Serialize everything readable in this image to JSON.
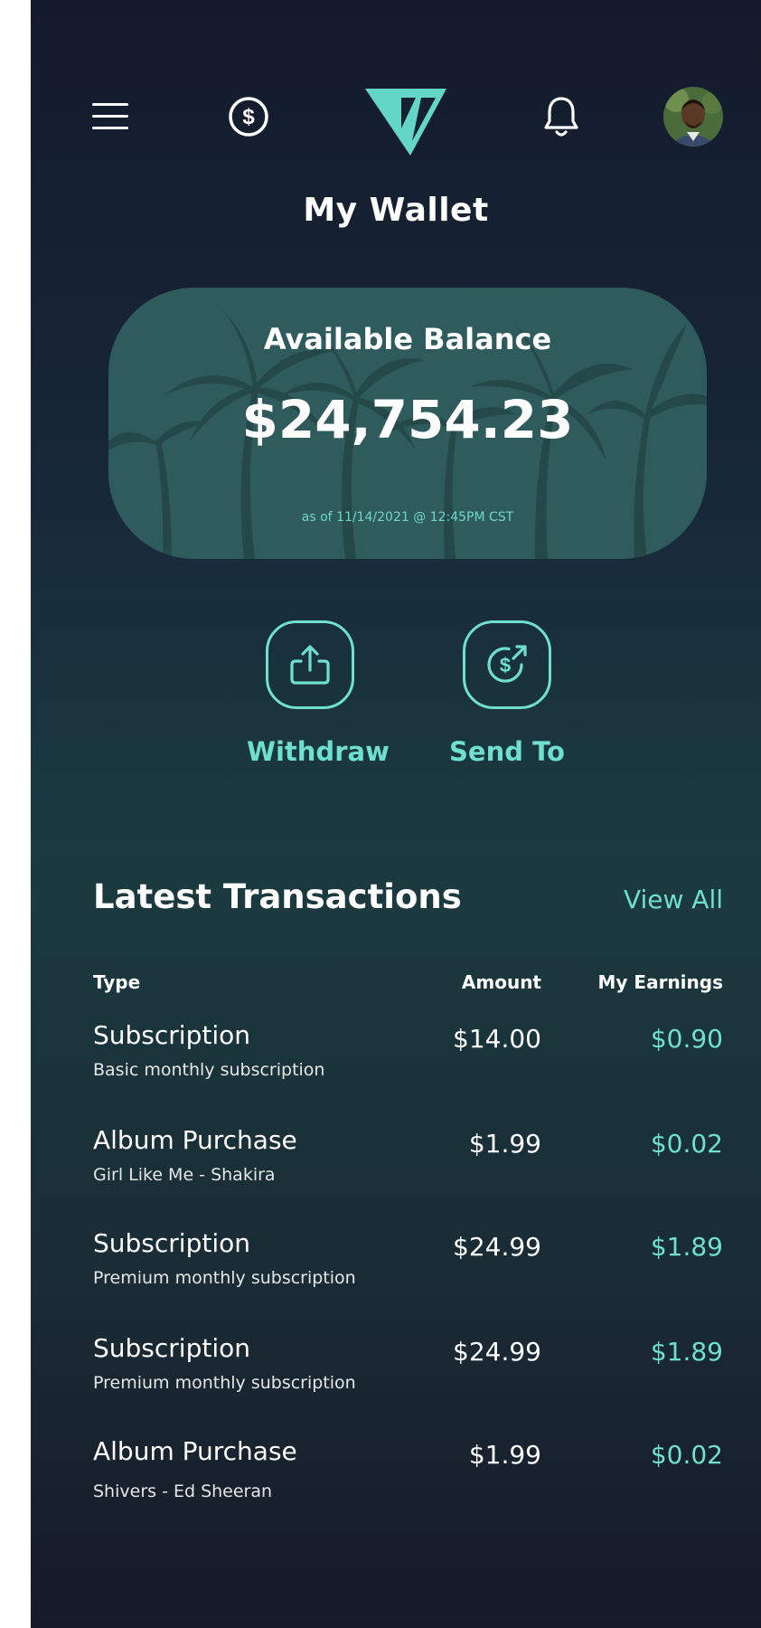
{
  "header": {
    "menu_icon": "hamburger-menu-icon",
    "coin_icon": "dollar-coin-icon",
    "logo": "brand-logo",
    "bell_icon": "bell-icon",
    "avatar": "user-avatar"
  },
  "page": {
    "title": "My Wallet"
  },
  "balance": {
    "label": "Available Balance",
    "amount": "$24,754.23",
    "as_of": "as of 11/14/2021 @ 12:45PM CST"
  },
  "actions": [
    {
      "label": "Withdraw",
      "icon": "upload-icon"
    },
    {
      "label": "Send To",
      "icon": "send-money-icon"
    }
  ],
  "transactions": {
    "title": "Latest Transactions",
    "view_all": "View All",
    "columns": {
      "type": "Type",
      "amount": "Amount",
      "earnings": "My Earnings"
    },
    "rows": [
      {
        "type": "Subscription",
        "detail": "Basic monthly subscription",
        "amount": "$14.00",
        "earnings": "$0.90"
      },
      {
        "type": "Album Purchase",
        "detail": "Girl Like Me - Shakira",
        "amount": "$1.99",
        "earnings": "$0.02"
      },
      {
        "type": "Subscription",
        "detail": "Premium monthly subscription",
        "amount": "$24.99",
        "earnings": "$1.89"
      },
      {
        "type": "Subscription",
        "detail": "Premium monthly subscription",
        "amount": "$24.99",
        "earnings": "$1.89"
      },
      {
        "type": "Album Purchase",
        "detail": "Shivers - Ed Sheeran",
        "amount": "$1.99",
        "earnings": "$0.02"
      }
    ]
  },
  "colors": {
    "accent": "#6fe0cd",
    "background_top": "#131a2b",
    "background_mid": "#1b3b40",
    "card": "#2f5b5c"
  }
}
